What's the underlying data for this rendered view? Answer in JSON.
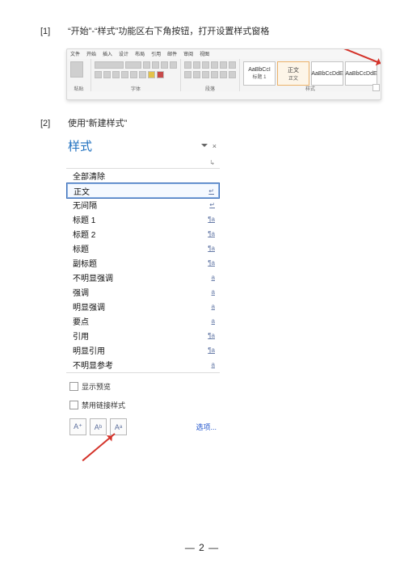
{
  "step1": {
    "num": "[1]",
    "text": "“开始”-“样式”功能区右下角按钮，打开设置样式窗格"
  },
  "ribbon": {
    "tabs": [
      "文件",
      "开始",
      "插入",
      "设计",
      "布局",
      "引用",
      "邮件",
      "审阅",
      "视图"
    ],
    "group_labels": {
      "clipboard": "粘贴",
      "font": "字体",
      "paragraph": "段落",
      "styles": "样式"
    },
    "style_tiles": [
      {
        "sample": "AaBbCcI",
        "name": "标题 1"
      },
      {
        "sample": "正文",
        "name": "正文"
      },
      {
        "sample": "AaBbCcDdE",
        "name": ""
      },
      {
        "sample": "AaBbCcDdE",
        "name": ""
      }
    ]
  },
  "step2": {
    "num": "[2]",
    "text": "使用“新建样式”"
  },
  "pane": {
    "title": "样式",
    "caret_label": "▾",
    "close_label": "×",
    "inset_label": "↳",
    "items": [
      {
        "label": "全部清除",
        "kind": ""
      },
      {
        "label": "正文",
        "kind": "↵",
        "selected": true
      },
      {
        "label": "无间隔",
        "kind": "↵"
      },
      {
        "label": "标题 1",
        "kind": "¶a"
      },
      {
        "label": "标题 2",
        "kind": "¶a"
      },
      {
        "label": "标题",
        "kind": "¶a"
      },
      {
        "label": "副标题",
        "kind": "¶a"
      },
      {
        "label": "不明显强调",
        "kind": "a"
      },
      {
        "label": "强调",
        "kind": "a"
      },
      {
        "label": "明显强调",
        "kind": "a"
      },
      {
        "label": "要点",
        "kind": "a"
      },
      {
        "label": "引用",
        "kind": "¶a"
      },
      {
        "label": "明显引用",
        "kind": "¶a"
      },
      {
        "label": "不明显参考",
        "kind": "a"
      }
    ],
    "checks": {
      "preview": "显示预览",
      "linked": "禁用链接样式"
    },
    "btns": {
      "b1": "A⁺",
      "b2": "Aᵇ",
      "b3": "Aᵃ"
    },
    "options": "选项..."
  },
  "footer": "— 2 —"
}
